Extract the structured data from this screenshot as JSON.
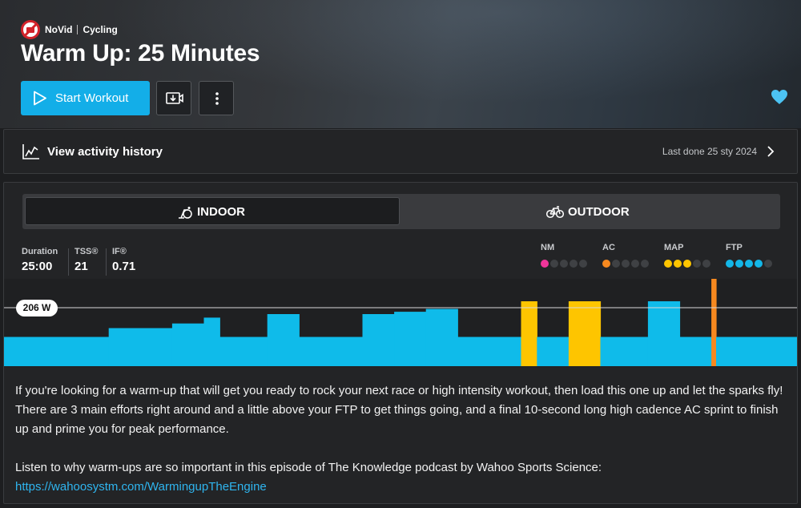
{
  "brand": {
    "name": "NoVid",
    "category": "Cycling"
  },
  "title": "Warm Up: 25 Minutes",
  "actions": {
    "start_label": "Start Workout"
  },
  "history": {
    "label": "View activity history",
    "last_done": "Last done 25 sty 2024"
  },
  "modes": {
    "indoor": "INDOOR",
    "outdoor": "OUTDOOR",
    "selected": "INDOOR"
  },
  "stats": {
    "duration_label": "Duration",
    "duration": "25:00",
    "tss_label": "TSS®",
    "tss": "21",
    "if_label": "IF®",
    "if": "0.71"
  },
  "zones": [
    {
      "label": "NM",
      "color": "#f0359a",
      "filled": 1
    },
    {
      "label": "AC",
      "color": "#f7891f",
      "filled": 1
    },
    {
      "label": "MAP",
      "color": "#fec500",
      "filled": 3
    },
    {
      "label": "FTP",
      "color": "#13b7e8",
      "filled": 4
    }
  ],
  "chart": {
    "ftp_label": "206 W",
    "colors": {
      "ftp": "#0fbbea",
      "map": "#fec500",
      "ac": "#f7891f"
    },
    "segments": [
      {
        "start": 0,
        "end": 3.3,
        "level": 0.5,
        "zone": "ftp"
      },
      {
        "start": 3.3,
        "end": 5.3,
        "level": 0.65,
        "zone": "ftp"
      },
      {
        "start": 5.3,
        "end": 6.3,
        "level": 0.73,
        "zone": "ftp"
      },
      {
        "start": 6.3,
        "end": 6.8,
        "level": 0.83,
        "zone": "ftp"
      },
      {
        "start": 6.8,
        "end": 8.3,
        "level": 0.5,
        "zone": "ftp"
      },
      {
        "start": 8.3,
        "end": 9.3,
        "level": 0.89,
        "zone": "ftp"
      },
      {
        "start": 9.3,
        "end": 11.3,
        "level": 0.5,
        "zone": "ftp"
      },
      {
        "start": 11.3,
        "end": 12.3,
        "level": 0.89,
        "zone": "ftp"
      },
      {
        "start": 12.3,
        "end": 13.3,
        "level": 0.93,
        "zone": "ftp"
      },
      {
        "start": 13.3,
        "end": 14.3,
        "level": 0.98,
        "zone": "ftp"
      },
      {
        "start": 14.3,
        "end": 16.3,
        "level": 0.5,
        "zone": "ftp"
      },
      {
        "start": 16.3,
        "end": 16.8,
        "level": 1.11,
        "zone": "map"
      },
      {
        "start": 16.8,
        "end": 17.8,
        "level": 0.5,
        "zone": "ftp"
      },
      {
        "start": 17.8,
        "end": 18.8,
        "level": 1.11,
        "zone": "map"
      },
      {
        "start": 18.8,
        "end": 20.3,
        "level": 0.5,
        "zone": "ftp"
      },
      {
        "start": 20.3,
        "end": 21.3,
        "level": 1.11,
        "zone": "ftp"
      },
      {
        "start": 21.3,
        "end": 22.3,
        "level": 0.5,
        "zone": "ftp"
      },
      {
        "start": 22.3,
        "end": 22.45,
        "level": 1.5,
        "zone": "ac"
      },
      {
        "start": 22.45,
        "end": 25,
        "level": 0.5,
        "zone": "ftp"
      }
    ]
  },
  "description": {
    "p1": "If you're looking for a warm-up that will get you ready to rock your next race or high intensity workout, then load this one up and let the sparks fly! There are 3 main efforts right around and a little above your FTP to get things going, and a final 10-second long high cadence AC sprint to finish up and prime you for peak performance.",
    "p2": "Listen to why warm-ups are so important in this episode of The Knowledge podcast by Wahoo Sports Science:",
    "link": "https://wahoosystm.com/WarmingupTheEngine"
  }
}
